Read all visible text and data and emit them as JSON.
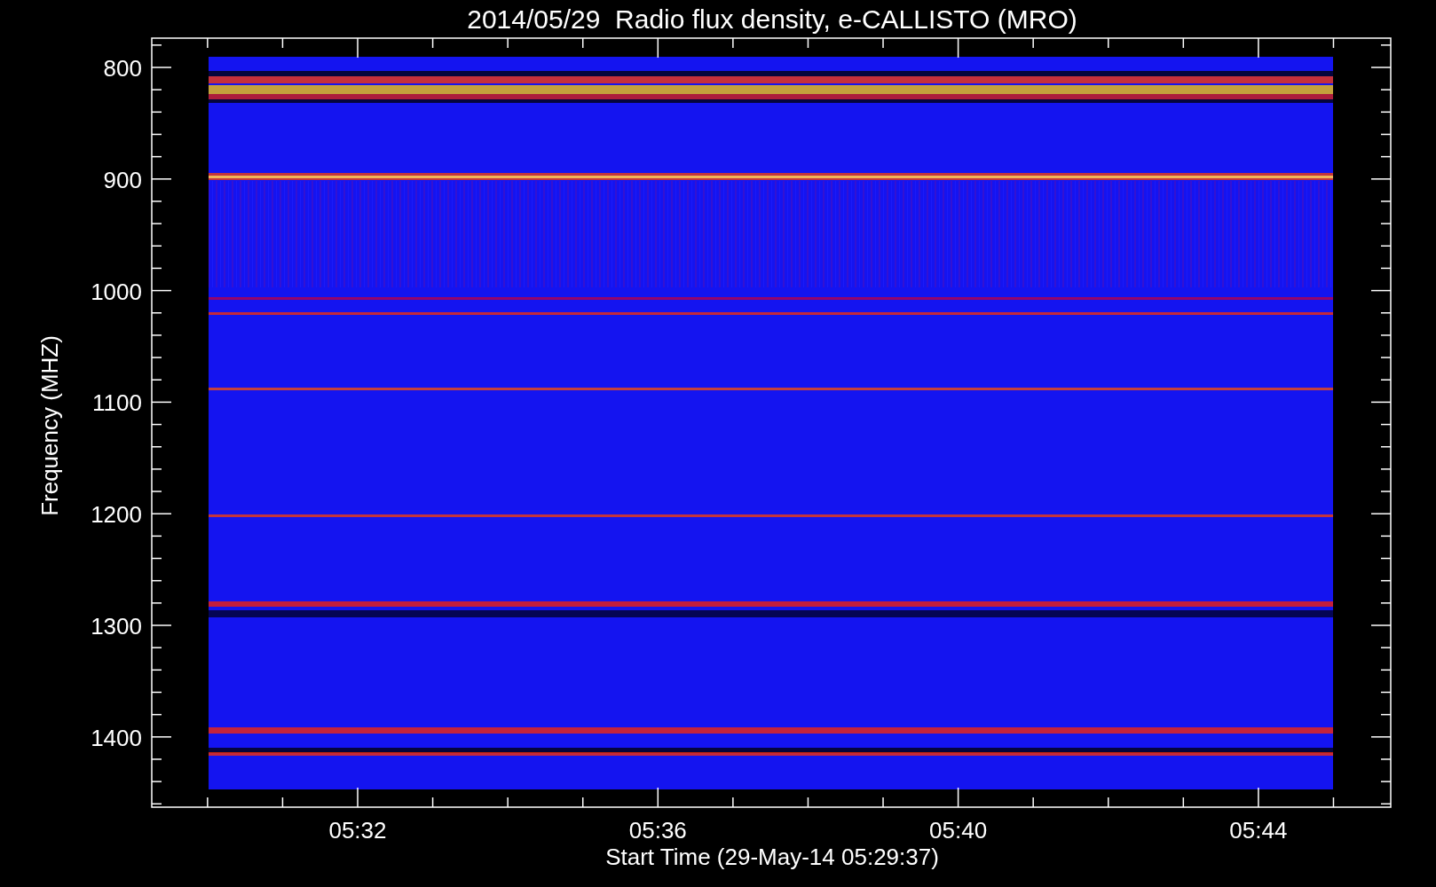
{
  "title": "2014/05/29  Radio flux density, e-CALLISTO (MRO)",
  "ylabel": "Frequency (MHZ)",
  "xlabel": "Start Time (29-May-14 05:29:37)",
  "yticks": [
    "800",
    "900",
    "1000",
    "1100",
    "1200",
    "1300",
    "1400"
  ],
  "xticks": [
    "05:32",
    "05:36",
    "05:40",
    "05:44"
  ]
}
